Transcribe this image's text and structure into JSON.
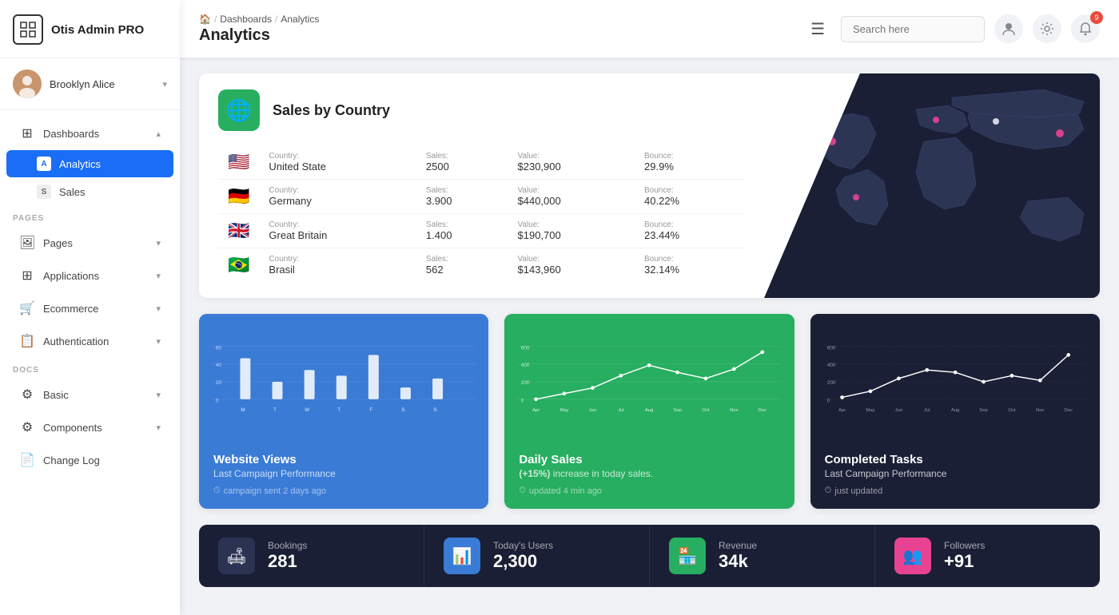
{
  "sidebar": {
    "logo_icon": "⊞",
    "logo_title": "Otis Admin PRO",
    "user_name": "Brooklyn Alice",
    "user_avatar_emoji": "👩",
    "nav": {
      "dashboards_label": "Dashboards",
      "analytics_label": "Analytics",
      "sales_label": "Sales",
      "pages_section": "PAGES",
      "pages_label": "Pages",
      "applications_label": "Applications",
      "ecommerce_label": "Ecommerce",
      "authentication_label": "Authentication",
      "docs_section": "DOCS",
      "basic_label": "Basic",
      "components_label": "Components",
      "changelog_label": "Change Log"
    }
  },
  "topbar": {
    "breadcrumb_home": "⌂",
    "breadcrumb_dashboards": "Dashboards",
    "breadcrumb_analytics": "Analytics",
    "page_title": "Analytics",
    "search_placeholder": "Search here",
    "notification_count": "9"
  },
  "sales_card": {
    "title": "Sales by Country",
    "rows": [
      {
        "flag": "🇺🇸",
        "country_label": "Country:",
        "country": "United State",
        "sales_label": "Sales:",
        "sales": "2500",
        "value_label": "Value:",
        "value": "$230,900",
        "bounce_label": "Bounce:",
        "bounce": "29.9%"
      },
      {
        "flag": "🇩🇪",
        "country_label": "Country:",
        "country": "Germany",
        "sales_label": "Sales:",
        "sales": "3.900",
        "value_label": "Value:",
        "value": "$440,000",
        "bounce_label": "Bounce:",
        "bounce": "40.22%"
      },
      {
        "flag": "🇬🇧",
        "country_label": "Country:",
        "country": "Great Britain",
        "sales_label": "Sales:",
        "sales": "1.400",
        "value_label": "Value:",
        "value": "$190,700",
        "bounce_label": "Bounce:",
        "bounce": "23.44%"
      },
      {
        "flag": "🇧🇷",
        "country_label": "Country:",
        "country": "Brasil",
        "sales_label": "Sales:",
        "sales": "562",
        "value_label": "Value:",
        "value": "$143,960",
        "bounce_label": "Bounce:",
        "bounce": "32.14%"
      }
    ]
  },
  "website_views": {
    "title": "Website Views",
    "subtitle": "Last Campaign Performance",
    "meta": "campaign sent 2 days ago",
    "y_labels": [
      "60",
      "40",
      "20",
      "0"
    ],
    "x_labels": [
      "M",
      "T",
      "W",
      "T",
      "F",
      "S",
      "S"
    ]
  },
  "daily_sales": {
    "title": "Daily Sales",
    "subtitle_pre": "",
    "highlight": "(+15%)",
    "subtitle_post": " increase in today sales.",
    "meta": "updated 4 min ago",
    "y_labels": [
      "600",
      "400",
      "200",
      "0"
    ],
    "x_labels": [
      "Apr",
      "May",
      "Jun",
      "Jul",
      "Aug",
      "Sep",
      "Oct",
      "Nov",
      "Dec"
    ]
  },
  "completed_tasks": {
    "title": "Completed Tasks",
    "subtitle": "Last Campaign Performance",
    "meta": "just updated",
    "y_labels": [
      "600",
      "400",
      "200",
      "0"
    ],
    "x_labels": [
      "Apr",
      "May",
      "Jun",
      "Jul",
      "Aug",
      "Sep",
      "Oct",
      "Nov",
      "Dec"
    ]
  },
  "stats": [
    {
      "icon": "🛋",
      "icon_class": "dark-grey",
      "label": "Bookings",
      "value": "281"
    },
    {
      "icon": "📊",
      "icon_class": "blue",
      "label": "Today's Users",
      "value": "2,300"
    },
    {
      "icon": "🏪",
      "icon_class": "green",
      "label": "Revenue",
      "value": "34k"
    },
    {
      "icon": "👥",
      "icon_class": "pink",
      "label": "Followers",
      "value": "+91"
    }
  ]
}
